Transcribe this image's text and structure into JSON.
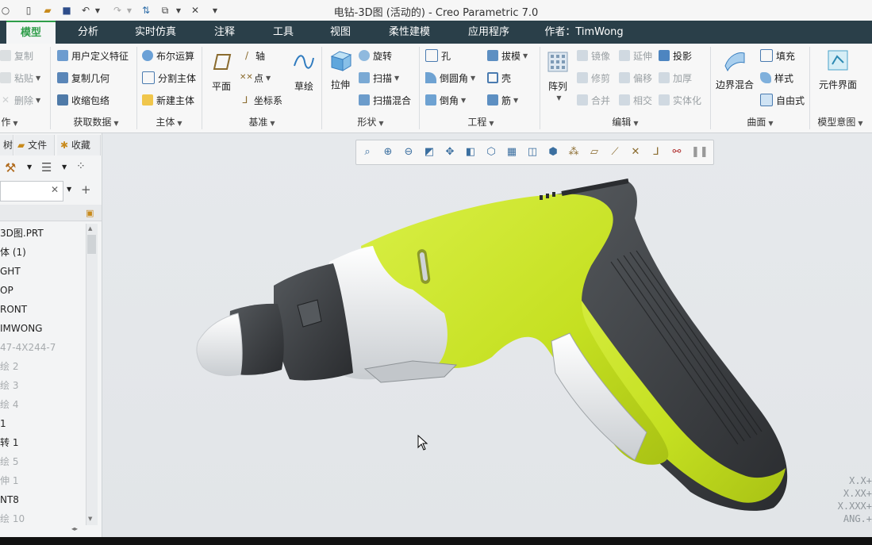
{
  "window": {
    "title": "电钻-3D图 (活动的) - Creo Parametric 7.0"
  },
  "quick_access": [
    "new",
    "open",
    "save",
    "undo",
    "redo",
    "regenerate",
    "windows",
    "close"
  ],
  "tabs": [
    {
      "label": "模型",
      "active": true
    },
    {
      "label": "分析"
    },
    {
      "label": "实时仿真"
    },
    {
      "label": "注释"
    },
    {
      "label": "工具"
    },
    {
      "label": "视图"
    },
    {
      "label": "柔性建模"
    },
    {
      "label": "应用程序"
    },
    {
      "label": "作者：TimWong"
    }
  ],
  "ribbon": {
    "operations": {
      "copy": "复制",
      "paste": "粘贴",
      "delete": "删除",
      "group": "作"
    },
    "get_data": {
      "udf": "用户定义特征",
      "copy_geom": "复制几何",
      "shrinkwrap": "收缩包络",
      "group": "获取数据"
    },
    "body": {
      "boolean": "布尔运算",
      "split": "分割主体",
      "new": "新建主体",
      "group": "主体"
    },
    "datum": {
      "plane": "平面",
      "axis": "轴",
      "point": "点",
      "csys": "坐标系",
      "sketch": "草绘",
      "group": "基准"
    },
    "shapes": {
      "extrude": "拉伸",
      "revolve": "旋转",
      "sweep": "扫描",
      "swept_blend": "扫描混合",
      "group": "形状"
    },
    "engineering": {
      "hole": "孔",
      "round": "倒圆角",
      "chamfer": "倒角",
      "draft": "拔模",
      "shell": "壳",
      "rib": "筋",
      "group": "工程"
    },
    "editing": {
      "pattern": "阵列",
      "mirror": "镜像",
      "extend": "延伸",
      "project": "投影",
      "trim": "修剪",
      "offset": "偏移",
      "thicken": "加厚",
      "merge": "合并",
      "intersect": "相交",
      "solidify": "实体化",
      "group": "编辑"
    },
    "surfaces": {
      "boundary_blend": "边界混合",
      "fill": "填充",
      "style": "样式",
      "freestyle": "自由式",
      "group": "曲面"
    },
    "model_intent": {
      "component_interface": "元件界面",
      "group": "模型意图"
    }
  },
  "left_panel": {
    "tabs": [
      "树",
      "文件",
      "收藏"
    ],
    "search_placeholder": "",
    "tree": [
      {
        "label": "3D图.PRT"
      },
      {
        "label": "体 (1)"
      },
      {
        "label": "GHT"
      },
      {
        "label": "OP"
      },
      {
        "label": "RONT"
      },
      {
        "label": "IMWONG"
      },
      {
        "label": "47-4X244-7",
        "dim": true
      },
      {
        "label": "绘 2",
        "dim": true
      },
      {
        "label": "绘 3",
        "dim": true
      },
      {
        "label": "绘 4",
        "dim": true
      },
      {
        "label": "1"
      },
      {
        "label": "转 1"
      },
      {
        "label": "绘 5",
        "dim": true
      },
      {
        "label": "伸 1",
        "dim": true
      },
      {
        "label": "NT8"
      },
      {
        "label": "绘 10",
        "dim": true
      }
    ]
  },
  "view_toolbar": [
    "refit-icon",
    "zoom-in-icon",
    "zoom-out-icon",
    "repaint-icon",
    "pan-zoom-icon",
    "display-style-icon",
    "saved-views-icon",
    "view-manager-icon",
    "perspective-icon",
    "spin-center-icon",
    "datum-display-icon",
    "plane-display-icon",
    "axis-display-icon",
    "point-display-icon",
    "csys-display-icon",
    "annotation-display-icon",
    "pause-icon"
  ],
  "coords": [
    "X.X+",
    "X.XX+",
    "X.XXX+",
    "ANG.+"
  ],
  "colors": {
    "model_lime": "#c9e326",
    "model_dark": "#3a3d40",
    "model_silver": "#e8eaec",
    "tab_bar": "#2a3f49",
    "accent_green": "#2e9d49"
  }
}
